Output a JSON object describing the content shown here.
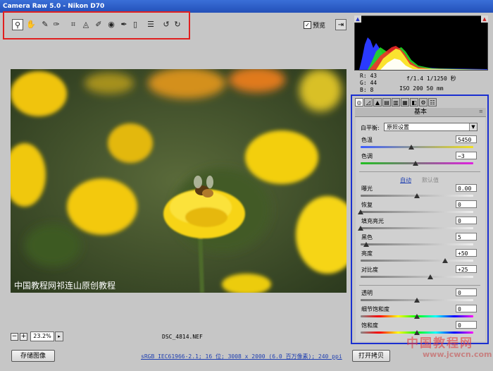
{
  "window": {
    "title": "Camera Raw 5.0 - Nikon D70"
  },
  "toolbar": {
    "tools": [
      {
        "name": "zoom-icon",
        "glyph": "⚲"
      },
      {
        "name": "hand-icon",
        "glyph": "✋"
      },
      {
        "name": "white-balance-icon",
        "glyph": "✎"
      },
      {
        "name": "color-sampler-icon",
        "glyph": "✑"
      },
      {
        "name": "crop-icon",
        "glyph": "⌗"
      },
      {
        "name": "straighten-icon",
        "glyph": "◬"
      },
      {
        "name": "retouch-icon",
        "glyph": "✐"
      },
      {
        "name": "red-eye-icon",
        "glyph": "◉"
      },
      {
        "name": "adjustment-brush-icon",
        "glyph": "✒"
      },
      {
        "name": "graduated-filter-icon",
        "glyph": "▯"
      },
      {
        "name": "preferences-icon",
        "glyph": "☰"
      },
      {
        "name": "rotate-left-icon",
        "glyph": "↺"
      },
      {
        "name": "rotate-right-icon",
        "glyph": "↻"
      }
    ],
    "preview_label": "预览",
    "preview_checked": "✓",
    "fullscreen_glyph": "⇥"
  },
  "photo": {
    "caption": "中国教程网祁连山原创教程"
  },
  "zoom": {
    "minus": "−",
    "plus": "+",
    "value": "23.2%",
    "dropdown": "▸"
  },
  "filename": "DSC_4814.NEF",
  "buttons": {
    "save": "存储图像",
    "open": "打开拷贝"
  },
  "workflow": "sRGB IEC61966-2.1; 16 位; 3008 x 2000 (6.0 百万像素); 240 ppi",
  "readout": {
    "r": "R:   43",
    "g": "G:   44",
    "b": "B:    8",
    "aperture_shutter": "f/1.4  1/1250 秒",
    "iso_focal": "ISO 200  50 mm"
  },
  "histogram": {
    "clip_left": "▲",
    "clip_right": "▲"
  },
  "panel": {
    "tabs": [
      "◎",
      "◿",
      "▲",
      "▤",
      "▥",
      "▦",
      "◧",
      "⚙",
      "☷"
    ],
    "title": "基本",
    "menu": "≡",
    "white_balance_label": "白平衡:",
    "white_balance_value": "原照设置",
    "dropdown_glyph": "▼",
    "auto_label": "自动",
    "default_label": "默认值",
    "sliders": [
      {
        "key": "temp",
        "label": "色温",
        "value": "5450",
        "level": 0.45
      },
      {
        "key": "tint",
        "label": "色调",
        "value": "−3",
        "level": 0.49
      },
      {
        "key": "exposure",
        "label": "曝光",
        "value": "0.00",
        "level": 0.5
      },
      {
        "key": "recovery",
        "label": "恢复",
        "value": "0",
        "level": 0.0
      },
      {
        "key": "fill",
        "label": "填充亮光",
        "value": "0",
        "level": 0.0
      },
      {
        "key": "blacks",
        "label": "黑色",
        "value": "5",
        "level": 0.05
      },
      {
        "key": "brightness",
        "label": "亮度",
        "value": "+50",
        "level": 0.75
      },
      {
        "key": "contrast",
        "label": "对比度",
        "value": "+25",
        "level": 0.62
      },
      {
        "key": "clarity",
        "label": "透明",
        "value": "0",
        "level": 0.5
      },
      {
        "key": "vibrance",
        "label": "细节饱和度",
        "value": "0",
        "level": 0.5
      },
      {
        "key": "saturation",
        "label": "饱和度",
        "value": "0",
        "level": 0.5
      }
    ]
  },
  "watermark": {
    "line1": "中国教程网",
    "line2": "www.jcwcn.com"
  },
  "colors": {
    "highlight_toolbar": "#e02020",
    "highlight_panel": "#1a2fd0",
    "link": "#1f3fb0"
  }
}
